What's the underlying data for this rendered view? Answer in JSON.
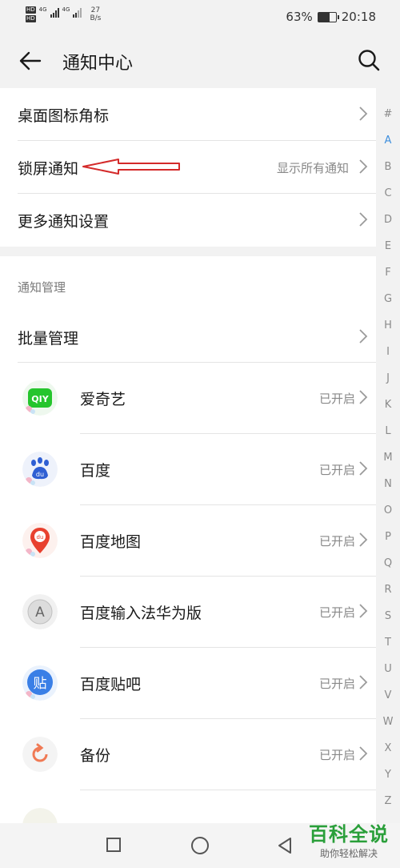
{
  "status_bar": {
    "left_top_label": "HD",
    "left_bottom_label": "HD",
    "network_1": "4G",
    "network_2": "4G",
    "speed_value": "27",
    "speed_unit": "B/s",
    "battery_percent": "63%",
    "battery_level": 0.63,
    "time": "20:18"
  },
  "header": {
    "title": "通知中心"
  },
  "settings": [
    {
      "label": "桌面图标角标",
      "value": ""
    },
    {
      "label": "锁屏通知",
      "value": "显示所有通知"
    },
    {
      "label": "更多通知设置",
      "value": ""
    }
  ],
  "manage_section": {
    "title": "通知管理",
    "batch_label": "批量管理"
  },
  "apps": [
    {
      "name": "爱奇艺",
      "status": "已开启",
      "icon": "iqiyi-icon",
      "icon_text": "QIY",
      "color": "#25c52d"
    },
    {
      "name": "百度",
      "status": "已开启",
      "icon": "baidu-icon",
      "icon_text": "du",
      "color": "#2f5fd3"
    },
    {
      "name": "百度地图",
      "status": "已开启",
      "icon": "baidu-map-icon",
      "icon_text": "du",
      "color": "#e8412f"
    },
    {
      "name": "百度输入法华为版",
      "status": "已开启",
      "icon": "baidu-ime-icon",
      "icon_text": "A",
      "color": "#9a9a9a"
    },
    {
      "name": "百度贴吧",
      "status": "已开启",
      "icon": "tieba-icon",
      "icon_text": "贴",
      "color": "#3a7fe6"
    },
    {
      "name": "备份",
      "status": "已开启",
      "icon": "backup-icon",
      "icon_text": "",
      "color": "#f07a55"
    }
  ],
  "alphabet_index": [
    "#",
    "A",
    "B",
    "C",
    "D",
    "E",
    "F",
    "G",
    "H",
    "I",
    "J",
    "K",
    "L",
    "M",
    "N",
    "O",
    "P",
    "Q",
    "R",
    "S",
    "T",
    "U",
    "V",
    "W",
    "X",
    "Y",
    "Z"
  ],
  "active_index": "A",
  "watermark": {
    "main": "百科全说",
    "sub": "助你轻松解决"
  },
  "colors": {
    "accent": "#3e8fdd",
    "annotation_arrow": "#d42a2a",
    "watermark_green": "#2a9f3a"
  }
}
